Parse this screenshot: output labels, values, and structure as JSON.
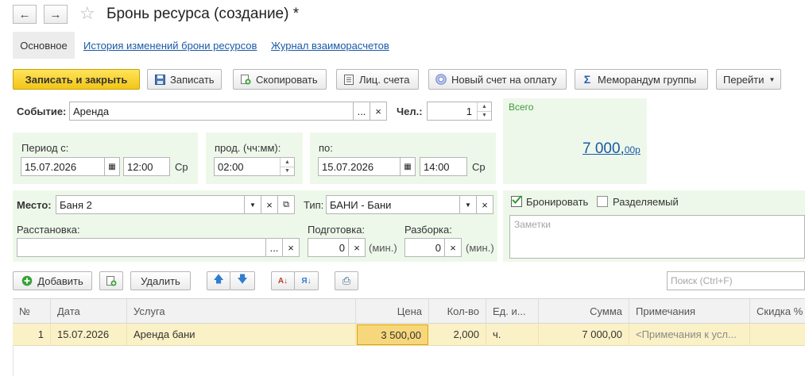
{
  "header": {
    "title": "Бронь ресурса (создание) *",
    "back_glyph": "←",
    "forward_glyph": "→",
    "star_glyph": "☆"
  },
  "tabs": {
    "main": "Основное",
    "history": "История изменений брони ресурсов",
    "journal": "Журнал взаиморасчетов"
  },
  "toolbar": {
    "save_close": "Записать и закрыть",
    "save": "Записать",
    "copy": "Скопировать",
    "accounts": "Лиц. счета",
    "new_invoice": "Новый счет на оплату",
    "memo": "Меморандум группы",
    "goto": "Перейти"
  },
  "form": {
    "event_label": "Событие:",
    "event_value": "Аренда",
    "persons_label": "Чел.:",
    "persons_value": "1",
    "total_label": "Всего",
    "total_main": "7 000,",
    "total_cents": "00р",
    "period_from_label": "Период с:",
    "date_from": "15.07.2026",
    "time_from": "12:00",
    "day_from": "Ср",
    "duration_label": "прод. (чч:мм):",
    "duration_value": "02:00",
    "to_label": "по:",
    "date_to": "15.07.2026",
    "time_to": "14:00",
    "day_to": "Ср",
    "place_label": "Место:",
    "place_value": "Баня 2",
    "type_label": "Тип:",
    "type_value": "БАНИ - Бани",
    "book_label": "Бронировать",
    "shared_label": "Разделяемый",
    "notes_placeholder": "Заметки",
    "arrangement_label": "Расстановка:",
    "arrangement_value": "",
    "prep_label": "Подготовка:",
    "prep_value": "0",
    "prep_unit": "(мин.)",
    "teardown_label": "Разборка:",
    "teardown_value": "0",
    "teardown_unit": "(мин.)"
  },
  "table_toolbar": {
    "add": "Добавить",
    "delete": "Удалить",
    "search_placeholder": "Поиск (Ctrl+F)"
  },
  "table": {
    "columns": [
      "№",
      "Дата",
      "Услуга",
      "Цена",
      "Кол-во",
      "Ед. и...",
      "Сумма",
      "Примечания",
      "Скидка %"
    ],
    "rows": [
      {
        "num": "1",
        "date": "15.07.2026",
        "service": "Аренда бани",
        "price": "3 500,00",
        "qty": "2,000",
        "unit": "ч.",
        "sum": "7 000,00",
        "notes": "<Примечания к усл...",
        "discount": ""
      }
    ]
  },
  "colors": {
    "accent_yellow": "#f3c515",
    "panel_green": "#eef8ea",
    "link_blue": "#1a5aa6",
    "total_label_green": "#3c9a3c",
    "row_highlight": "#fbf1c6"
  }
}
